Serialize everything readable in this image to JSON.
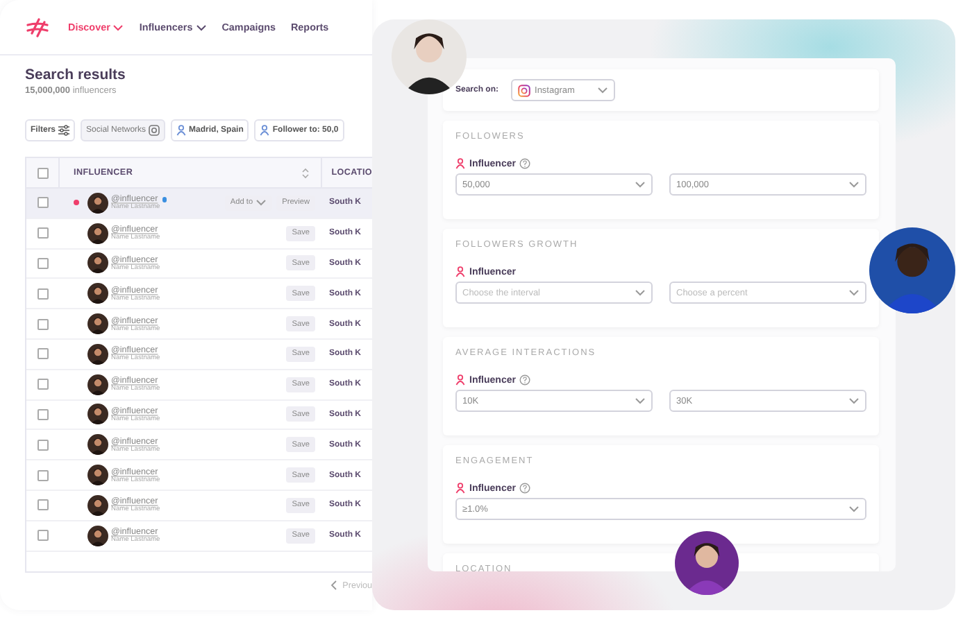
{
  "nav": {
    "items": [
      {
        "label": "Discover",
        "selected": true,
        "dropdown": true
      },
      {
        "label": "Influencers",
        "selected": false,
        "dropdown": true
      },
      {
        "label": "Campaigns",
        "selected": false,
        "dropdown": false
      },
      {
        "label": "Reports",
        "selected": false,
        "dropdown": false
      }
    ]
  },
  "header": {
    "title": "Search results",
    "count": "**15,000,000** influencers"
  },
  "filters": [
    {
      "label": "Filters",
      "kind": "filters"
    },
    {
      "label": "Social Networks",
      "kind": "network"
    },
    {
      "label": "Madrid, Spain",
      "kind": "person"
    },
    {
      "label": "Follower to: 50,0",
      "kind": "person"
    }
  ],
  "table": {
    "select_all": {
      "checked": false
    },
    "columns": [
      {
        "label": "INFLUENCER",
        "sortable": true
      },
      {
        "label": "LOCATIO",
        "sortable": false
      }
    ],
    "rows": [
      {
        "handle": "@influencer",
        "name": "Name Lastname",
        "location": "South K",
        "checked": false,
        "highlighted": true,
        "flagged": true,
        "verified": true,
        "actions": [
          {
            "label": "Add to",
            "kind": "dropdown"
          },
          {
            "label": "Preview",
            "kind": "button"
          }
        ]
      },
      {
        "handle": "@influencer",
        "name": "Name Lastname",
        "location": "South K",
        "checked": false,
        "highlighted": false,
        "flagged": false,
        "verified": false,
        "actions": [
          {
            "label": "Save",
            "kind": "button"
          }
        ]
      },
      {
        "handle": "@influencer",
        "name": "Name Lastname",
        "location": "South K",
        "checked": false,
        "highlighted": false,
        "flagged": false,
        "verified": false,
        "actions": [
          {
            "label": "Save",
            "kind": "button"
          }
        ]
      },
      {
        "handle": "@influencer",
        "name": "Name Lastname",
        "location": "South K",
        "checked": false,
        "highlighted": false,
        "flagged": false,
        "verified": false,
        "actions": [
          {
            "label": "Save",
            "kind": "button"
          }
        ]
      },
      {
        "handle": "@influencer",
        "name": "Name Lastname",
        "location": "South K",
        "checked": false,
        "highlighted": false,
        "flagged": false,
        "verified": false,
        "actions": [
          {
            "label": "Save",
            "kind": "button"
          }
        ]
      },
      {
        "handle": "@influencer",
        "name": "Name Lastname",
        "location": "South K",
        "checked": false,
        "highlighted": false,
        "flagged": false,
        "verified": false,
        "actions": [
          {
            "label": "Save",
            "kind": "button"
          }
        ]
      },
      {
        "handle": "@influencer",
        "name": "Name Lastname",
        "location": "South K",
        "checked": false,
        "highlighted": false,
        "flagged": false,
        "verified": false,
        "actions": [
          {
            "label": "Save",
            "kind": "button"
          }
        ]
      },
      {
        "handle": "@influencer",
        "name": "Name Lastname",
        "location": "South K",
        "checked": false,
        "highlighted": false,
        "flagged": false,
        "verified": false,
        "actions": [
          {
            "label": "Save",
            "kind": "button"
          }
        ]
      },
      {
        "handle": "@influencer",
        "name": "Name Lastname",
        "location": "South K",
        "checked": false,
        "highlighted": false,
        "flagged": false,
        "verified": false,
        "actions": [
          {
            "label": "Save",
            "kind": "button"
          }
        ]
      },
      {
        "handle": "@influencer",
        "name": "Name Lastname",
        "location": "South K",
        "checked": false,
        "highlighted": false,
        "flagged": false,
        "verified": false,
        "actions": [
          {
            "label": "Save",
            "kind": "button"
          }
        ]
      },
      {
        "handle": "@influencer",
        "name": "Name Lastname",
        "location": "South K",
        "checked": false,
        "highlighted": false,
        "flagged": false,
        "verified": false,
        "actions": [
          {
            "label": "Save",
            "kind": "button"
          }
        ]
      },
      {
        "handle": "@influencer",
        "name": "Name Lastname",
        "location": "South K",
        "checked": false,
        "highlighted": false,
        "flagged": false,
        "verified": false,
        "actions": [
          {
            "label": "Save",
            "kind": "button"
          }
        ]
      }
    ]
  },
  "pagination": {
    "previous": "Previou"
  },
  "search_form": {
    "search_on": {
      "label": "Search on:",
      "value": "Instagram"
    },
    "sections": [
      {
        "title": "FOLLOWERS",
        "label": "Influencer",
        "help": true,
        "fields": [
          {
            "value": "50,000"
          },
          {
            "value": "100,000"
          }
        ]
      },
      {
        "title": "FOLLOWERS GROWTH",
        "label": "Influencer",
        "help": false,
        "fields": [
          {
            "placeholder": "Choose the interval"
          },
          {
            "placeholder": "Choose a percent"
          }
        ]
      },
      {
        "title": "AVERAGE INTERACTIONS",
        "label": "Influencer",
        "help": true,
        "fields": [
          {
            "value": "10K"
          },
          {
            "value": "30K"
          }
        ]
      },
      {
        "title": "ENGAGEMENT",
        "label": "Influencer",
        "help": true,
        "fields": [
          {
            "value": "≥1.0%"
          }
        ]
      },
      {
        "title": "LOCATION"
      }
    ]
  }
}
